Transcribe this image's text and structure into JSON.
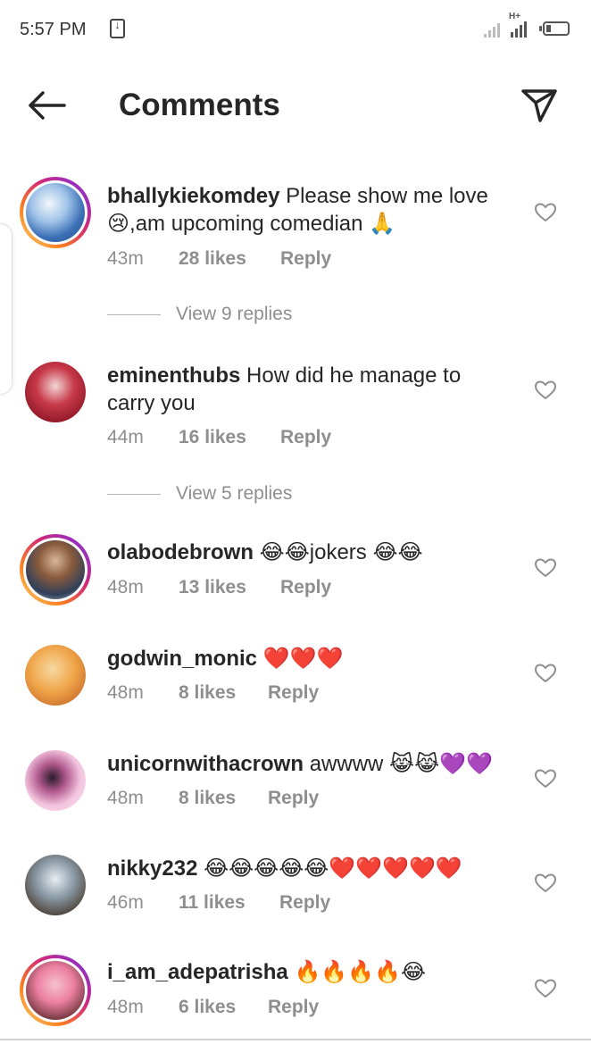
{
  "status_bar": {
    "time": "5:57 PM"
  },
  "header": {
    "title": "Comments"
  },
  "comments": [
    {
      "username": "bhallykiekomdey",
      "text": "Please show me love 😢,am upcoming comedian 🙏",
      "time": "43m",
      "likes": "28 likes",
      "reply": "Reply",
      "view_replies": "View 9 replies"
    },
    {
      "username": "eminenthubs",
      "text": "How did he manage to carry you",
      "time": "44m",
      "likes": "16 likes",
      "reply": "Reply",
      "view_replies": "View 5 replies"
    },
    {
      "username": "olabodebrown",
      "text": "😂😂jokers 😂😂",
      "time": "48m",
      "likes": "13 likes",
      "reply": "Reply"
    },
    {
      "username": "godwin_monic",
      "text": "❤️❤️❤️",
      "time": "48m",
      "likes": "8 likes",
      "reply": "Reply"
    },
    {
      "username": "unicornwithacrown",
      "text": "awwww 😹😹💜💜",
      "time": "48m",
      "likes": "8 likes",
      "reply": "Reply"
    },
    {
      "username": "nikky232",
      "text": "😂😂😂😂😂❤️❤️❤️❤️❤️",
      "time": "46m",
      "likes": "11 likes",
      "reply": "Reply"
    },
    {
      "username": "i_am_adepatrisha",
      "text": "🔥🔥🔥🔥😂",
      "time": "48m",
      "likes": "6 likes",
      "reply": "Reply"
    }
  ],
  "icons": {
    "back": "arrow-left-icon",
    "send": "paper-plane-icon",
    "like": "heart-outline-icon",
    "download": "download-icon",
    "signal": "signal-icon",
    "battery": "battery-icon"
  }
}
